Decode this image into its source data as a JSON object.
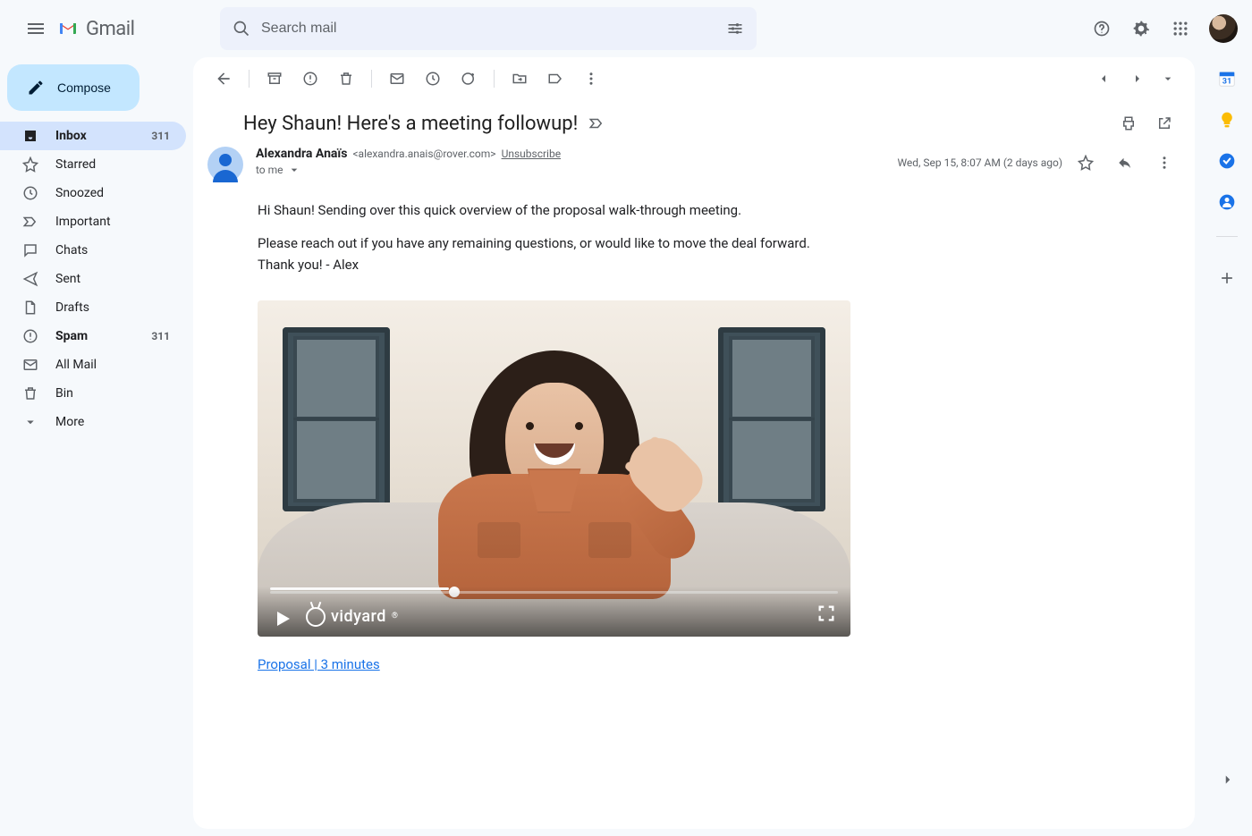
{
  "app": {
    "title": "Gmail"
  },
  "search": {
    "placeholder": "Search mail"
  },
  "compose": {
    "label": "Compose"
  },
  "sidebar": {
    "items": [
      {
        "label": "Inbox",
        "count": "311",
        "active": true,
        "bold": true
      },
      {
        "label": "Starred",
        "count": "",
        "active": false,
        "bold": false
      },
      {
        "label": "Snoozed",
        "count": "",
        "active": false,
        "bold": false
      },
      {
        "label": "Important",
        "count": "",
        "active": false,
        "bold": false
      },
      {
        "label": "Chats",
        "count": "",
        "active": false,
        "bold": false
      },
      {
        "label": "Sent",
        "count": "",
        "active": false,
        "bold": false
      },
      {
        "label": "Drafts",
        "count": "",
        "active": false,
        "bold": false
      },
      {
        "label": "Spam",
        "count": "311",
        "active": false,
        "bold": true
      },
      {
        "label": "All Mail",
        "count": "",
        "active": false,
        "bold": false
      },
      {
        "label": "Bin",
        "count": "",
        "active": false,
        "bold": false
      },
      {
        "label": "More",
        "count": "",
        "active": false,
        "bold": false
      }
    ]
  },
  "email": {
    "subject": "Hey Shaun! Here's a meeting followup!",
    "sender": {
      "name": "Alexandra Anaïs",
      "email": "<alexandra.anais@rover.com>"
    },
    "unsubscribe": "Unsubscribe",
    "to_line": "to me",
    "date": "Wed, Sep 15, 8:07 AM (2 days ago)",
    "body": {
      "p1": "Hi Shaun! Sending over this quick overview of the proposal walk-through meeting.",
      "p2": "Please reach out if you have any remaining questions, or would like to move the deal forward.",
      "p3": "Thank you! - Alex"
    },
    "video": {
      "provider": "vidyard",
      "link_text": "Proposal | 3 minutes"
    }
  }
}
